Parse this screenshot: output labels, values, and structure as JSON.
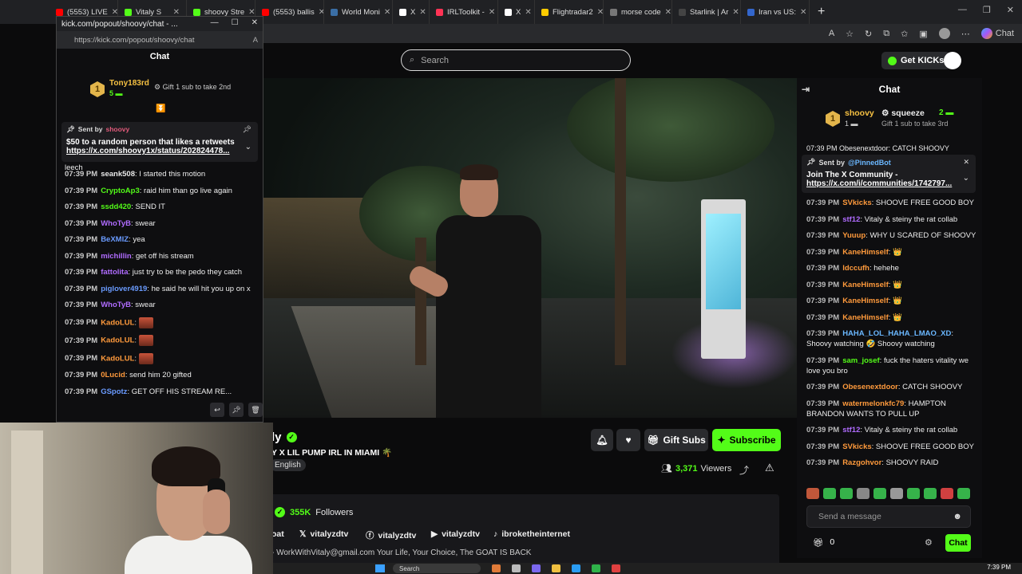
{
  "browser": {
    "tabs": [
      {
        "label": "(5553) LIVE",
        "color": "#ff0000"
      },
      {
        "label": "Vitaly S",
        "color": "#53fc18"
      },
      {
        "label": "shoovy Stre",
        "color": "#53fc18"
      },
      {
        "label": "(5553) ballis",
        "color": "#ff0000"
      },
      {
        "label": "World Moni",
        "color": "#3a6ea5"
      },
      {
        "label": "X",
        "color": "#ffffff",
        "narrow": true
      },
      {
        "label": "IRLToolkit -",
        "color": "#ff3355"
      },
      {
        "label": "X",
        "color": "#ffffff",
        "narrow": true
      },
      {
        "label": "Flightradar2",
        "color": "#ffcc00"
      },
      {
        "label": "morse code",
        "color": "#777777"
      },
      {
        "label": "Starlink | Ar",
        "color": "#444444"
      },
      {
        "label": "Iran vs US:",
        "color": "#3366cc"
      }
    ],
    "new_tab_symbol": "+",
    "copilot_label": "Chat"
  },
  "kick": {
    "search_placeholder": "Search",
    "get_kicks_label": "Get KICKs"
  },
  "stream": {
    "streamer_name": "ly",
    "title": "Y X LIL PUMP IRL IN MIAMI 🌴",
    "language": "English",
    "gift_subs_label": "Gift Subs",
    "subscribe_label": "Subscribe",
    "viewers_count": "3,371",
    "viewers_label": "Viewers",
    "followers_count": "355K",
    "followers_label": "Followers",
    "socials": [
      {
        "label": "oat",
        "icon": ""
      },
      {
        "label": "vitalyzdtv",
        "icon": "𝕏"
      },
      {
        "label": "vitalyzdtv",
        "icon": "ⓕ"
      },
      {
        "label": "vitalyzdtv",
        "icon": "▶"
      },
      {
        "label": "ibroketheinternet",
        "icon": "♪"
      }
    ],
    "bio": "- WorkWithVitaly@gmail.com Your Life, Your Choice, The GOAT IS BACK"
  },
  "main_chat": {
    "header": "Chat",
    "top_gifter_rank": "1",
    "top_gifter_name": "shoovy",
    "top_gifter_count": "1",
    "second_gifter_name": "squeeze",
    "second_gifter_count": "2",
    "gift_prompt": "Gift 1 sub to take 3rd",
    "partial_line": "07:39 PM Obesenextdoor: CATCH SHOOVY",
    "pinned_sent_by": "Sent by",
    "pinned_user": "@PinnedBot",
    "pinned_line1": "Join The X Community -",
    "pinned_link": "https://x.com/i/communities/1742797...",
    "messages": [
      {
        "time": "07:39 PM",
        "user": "SVkicks",
        "color": "#ff9a3c",
        "text": "SHOOVE FREE GOOD BOY"
      },
      {
        "time": "07:39 PM",
        "user": "stf12",
        "color": "#b06cff",
        "text": "Vitaly & steiny the rat collab"
      },
      {
        "time": "07:39 PM",
        "user": "Yuuup",
        "color": "#ff9a3c",
        "text": "WHY U SCARED OF SHOOVY"
      },
      {
        "time": "07:39 PM",
        "user": "KaneHimself",
        "color": "#ff9a3c",
        "text": "👑"
      },
      {
        "time": "07:39 PM",
        "user": "ldccufh",
        "color": "#ff9a3c",
        "text": "hehehe"
      },
      {
        "time": "07:39 PM",
        "user": "KaneHimself",
        "color": "#ff9a3c",
        "text": "👑"
      },
      {
        "time": "07:39 PM",
        "user": "KaneHimself",
        "color": "#ff9a3c",
        "text": "👑"
      },
      {
        "time": "07:39 PM",
        "user": "KaneHimself",
        "color": "#ff9a3c",
        "text": "👑"
      },
      {
        "time": "07:39 PM",
        "user": "HAHA_LOL_HAHA_LMAO_XD",
        "color": "#6ab7ff",
        "text": "Shoovy watching 🤣 Shoovy watching"
      },
      {
        "time": "07:39 PM",
        "user": "sam_josef",
        "color": "#53fc18",
        "text": "fuck the haters vitality we love you bro"
      },
      {
        "time": "07:39 PM",
        "user": "Obesenextdoor",
        "color": "#ff9a3c",
        "text": "CATCH SHOOVY"
      },
      {
        "time": "07:39 PM",
        "user": "watermelonkfc79",
        "color": "#ff9a3c",
        "text": "HAMPTON BRANDON WANTS TO PULL UP"
      },
      {
        "time": "07:39 PM",
        "user": "stf12",
        "color": "#b06cff",
        "text": "Vitaly & steiny the rat collab"
      },
      {
        "time": "07:39 PM",
        "user": "SVkicks",
        "color": "#ff9a3c",
        "text": "SHOOVE FREE GOOD BOY"
      },
      {
        "time": "07:39 PM",
        "user": "Razgohvor",
        "color": "#ff9a3c",
        "text": "SHOOVY RAID"
      }
    ],
    "send_placeholder": "Send a message",
    "kicks_count": "0",
    "chat_button": "Chat"
  },
  "popout": {
    "window_title": "kick.com/popout/shoovy/chat - ...",
    "url": "https://kick.com/popout/shoovy/chat",
    "header": "Chat",
    "gifter_rank": "1",
    "gifter_name": "Tony183rd",
    "gifter_count": "5",
    "gift_prompt": "Gift 1 sub to take 2nd",
    "pinned_sent_by": "Sent by",
    "pinned_user": "shoovy",
    "pinned_line1": "$50 to a random person that likes a retweets",
    "pinned_link": "https://x.com/shoovy1x/status/202824478...",
    "partial_line": "leech",
    "messages": [
      {
        "time": "07:39 PM",
        "user": "seank508",
        "color": "#e8e8e8",
        "text": "I started this motion"
      },
      {
        "time": "07:39 PM",
        "user": "CryptoAp3",
        "color": "#53fc18",
        "text": "raid him than go live again"
      },
      {
        "time": "07:39 PM",
        "user": "ssdd420",
        "color": "#53fc18",
        "text": "SEND IT"
      },
      {
        "time": "07:39 PM",
        "user": "WhoTyB",
        "color": "#b06cff",
        "text": "swear"
      },
      {
        "time": "07:39 PM",
        "user": "BeXMIZ",
        "color": "#6a9bff",
        "text": "yea"
      },
      {
        "time": "07:39 PM",
        "user": "michillin",
        "color": "#b06cff",
        "text": "get off his stream"
      },
      {
        "time": "07:39 PM",
        "user": "fattolita",
        "color": "#b06cff",
        "text": "just try to be the pedo they catch"
      },
      {
        "time": "07:39 PM",
        "user": "piglover4919",
        "color": "#6a9bff",
        "text": "he said he will hit you up on x"
      },
      {
        "time": "07:39 PM",
        "user": "WhoTyB",
        "color": "#b06cff",
        "text": "swear"
      },
      {
        "time": "07:39 PM",
        "user": "KadoLUL",
        "color": "#ff9a3c",
        "text": ""
      },
      {
        "time": "07:39 PM",
        "user": "KadoLUL",
        "color": "#ff9a3c",
        "text": ""
      },
      {
        "time": "07:39 PM",
        "user": "KadoLUL",
        "color": "#ff9a3c",
        "text": ""
      },
      {
        "time": "07:39 PM",
        "user": "0Lucid",
        "color": "#ff9a3c",
        "text": "send him 20 gifted"
      },
      {
        "time": "07:39 PM",
        "user": "GSpotz",
        "color": "#6a9bff",
        "text": "GET OFF HIS STREAM RE..."
      }
    ]
  },
  "taskbar": {
    "search_label": "Search",
    "clock": "7:39 PM"
  }
}
